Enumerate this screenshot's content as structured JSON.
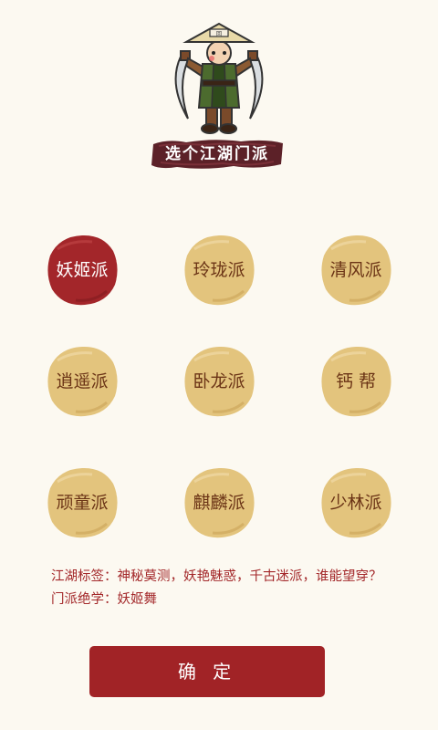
{
  "header": {
    "banner_title": "选个江湖门派"
  },
  "sects": [
    {
      "label": "妖姬派",
      "selected": true
    },
    {
      "label": "玲珑派",
      "selected": false
    },
    {
      "label": "清风派",
      "selected": false
    },
    {
      "label": "逍遥派",
      "selected": false
    },
    {
      "label": "卧龙派",
      "selected": false
    },
    {
      "label": "钙 帮",
      "selected": false
    },
    {
      "label": "顽童派",
      "selected": false
    },
    {
      "label": "麒麟派",
      "selected": false
    },
    {
      "label": "少林派",
      "selected": false
    }
  ],
  "info": {
    "tags_line": "江湖标签：神秘莫测，妖艳魅惑，千古迷派，谁能望穿？",
    "skill_line": "门派绝学：妖姬舞"
  },
  "confirm_button": {
    "label": "确 定"
  },
  "colors": {
    "background": "#fcf9f1",
    "selected_fill": "#a3262a",
    "unselected_fill": "#e3c47d",
    "unselected_text": "#6b3416",
    "accent_red": "#a12326",
    "banner_fill": "#5c2128"
  }
}
